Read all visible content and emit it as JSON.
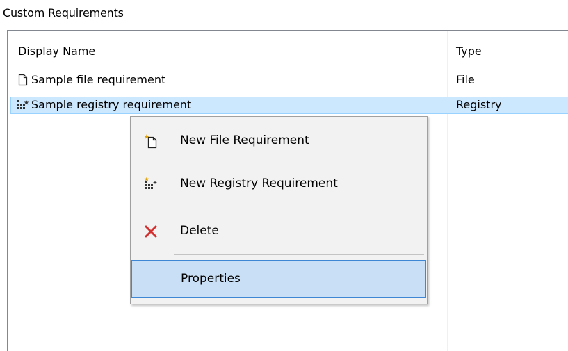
{
  "section_title": "Custom Requirements",
  "columns": {
    "name": "Display Name",
    "type": "Type"
  },
  "rows": [
    {
      "name": "Sample file requirement",
      "type": "File",
      "icon": "file-icon",
      "selected": false
    },
    {
      "name": "Sample registry requirement",
      "type": "Registry",
      "icon": "registry-icon",
      "selected": true
    }
  ],
  "context_menu": {
    "items": [
      {
        "label": "New File Requirement",
        "icon": "new-file-icon"
      },
      {
        "label": "New Registry Requirement",
        "icon": "new-registry-icon"
      },
      {
        "label": "Delete",
        "icon": "delete-icon"
      },
      {
        "label": "Properties",
        "icon": ""
      }
    ],
    "highlighted": "Properties"
  },
  "colors": {
    "selection_bg": "#cce8ff",
    "selection_border": "#99d1ff",
    "menu_bg": "#f2f2f2",
    "menu_highlight_bg": "#c9dff5",
    "menu_highlight_border": "#3d87d4",
    "delete_red": "#d32f2f"
  }
}
